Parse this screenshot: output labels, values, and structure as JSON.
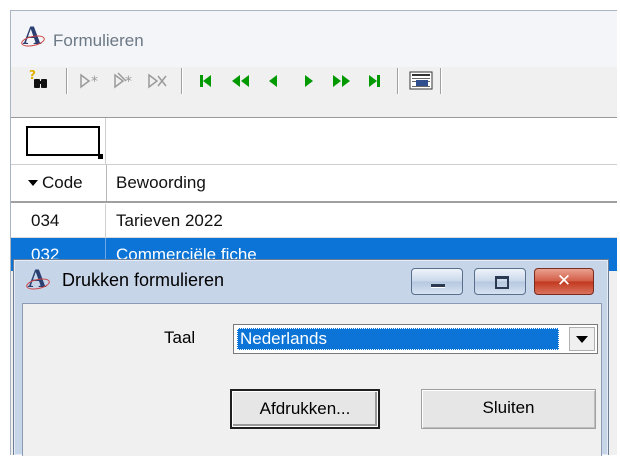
{
  "main_window": {
    "title": "Formulieren",
    "toolbar": {
      "icons": [
        "find-icon",
        "new-record-icon",
        "edit-record-icon",
        "delete-record-icon",
        "first-record-icon",
        "previous-page-icon",
        "previous-record-icon",
        "next-record-icon",
        "next-page-icon",
        "last-record-icon",
        "print-preview-icon"
      ],
      "find_glyph": "?",
      "nav_color": "#009900",
      "disabled_color": "#9a9a9a"
    },
    "grid": {
      "columns": [
        {
          "label": "Code"
        },
        {
          "label": "Bewoording"
        }
      ],
      "rows": [
        {
          "code": "034",
          "bewoording": "Tarieven 2022"
        },
        {
          "code": "032",
          "bewoording": "Commerciële fiche"
        }
      ],
      "selected_row": 1,
      "selection_color": "#0b74d6"
    }
  },
  "dialog": {
    "title": "Drukken formulieren",
    "close_glyph": "✕",
    "taal_label": "Taal",
    "taal_value": "Nederlands",
    "print_button": "Afdrukken...",
    "close_button": "Sluiten"
  }
}
